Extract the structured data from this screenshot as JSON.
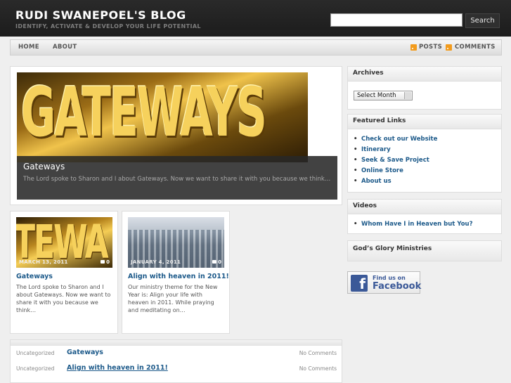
{
  "header": {
    "title": "RUDI SWANEPOEL'S BLOG",
    "tagline": "IDENTIFY, ACTIVATE & DEVELOP YOUR LIFE POTENTIAL",
    "search_placeholder": "",
    "search_button": "Search"
  },
  "nav": {
    "items": [
      {
        "label": "HOME"
      },
      {
        "label": "ABOUT"
      }
    ],
    "feeds": [
      {
        "label": "POSTS",
        "icon": "rss-icon"
      },
      {
        "label": "COMMENTS",
        "icon": "rss-icon"
      }
    ]
  },
  "featured": {
    "image_text": "GATEWAYS",
    "title": "Gateways",
    "excerpt": "The Lord spoke to Sharon and I about Gateways. Now we want to share it with you because we think…"
  },
  "cards": [
    {
      "image_text": "TEWA",
      "date": "MARCH 13, 2011",
      "comments": "0",
      "title": "Gateways",
      "excerpt": "The Lord spoke to Sharon and I about Gateways. Now we want to share it with you because we think…"
    },
    {
      "date": "JANUARY 4, 2011",
      "comments": "0",
      "title": "Align with heaven in 2011!",
      "excerpt": "Our ministry theme for the New Year is:  Align your life with heaven in 2011. While praying and meditating on…"
    }
  ],
  "recent": [
    {
      "category": "Uncategorized",
      "title": "Gateways",
      "comments": "No Comments"
    },
    {
      "category": "Uncategorized",
      "title": "Align with heaven in 2011!",
      "comments": "No Comments"
    }
  ],
  "sidebar": {
    "archives": {
      "title": "Archives",
      "select_value": "Select Month"
    },
    "featured_links": {
      "title": "Featured Links",
      "items": [
        "Check out our Website",
        "Itinerary",
        "Seek & Save Project",
        "Online Store",
        "About us"
      ]
    },
    "videos": {
      "title": "Videos",
      "items": [
        "Whom Have I in Heaven but You?"
      ]
    },
    "ministries": {
      "title": "God’s Glory Ministries"
    },
    "facebook": {
      "line1": "Find us on",
      "line2": "Facebook",
      "logo": "f"
    }
  },
  "colors": {
    "link": "#1d5a8a",
    "header_bg": "#1c1c1c",
    "rss": "#f29b1d",
    "facebook": "#3b5998"
  }
}
